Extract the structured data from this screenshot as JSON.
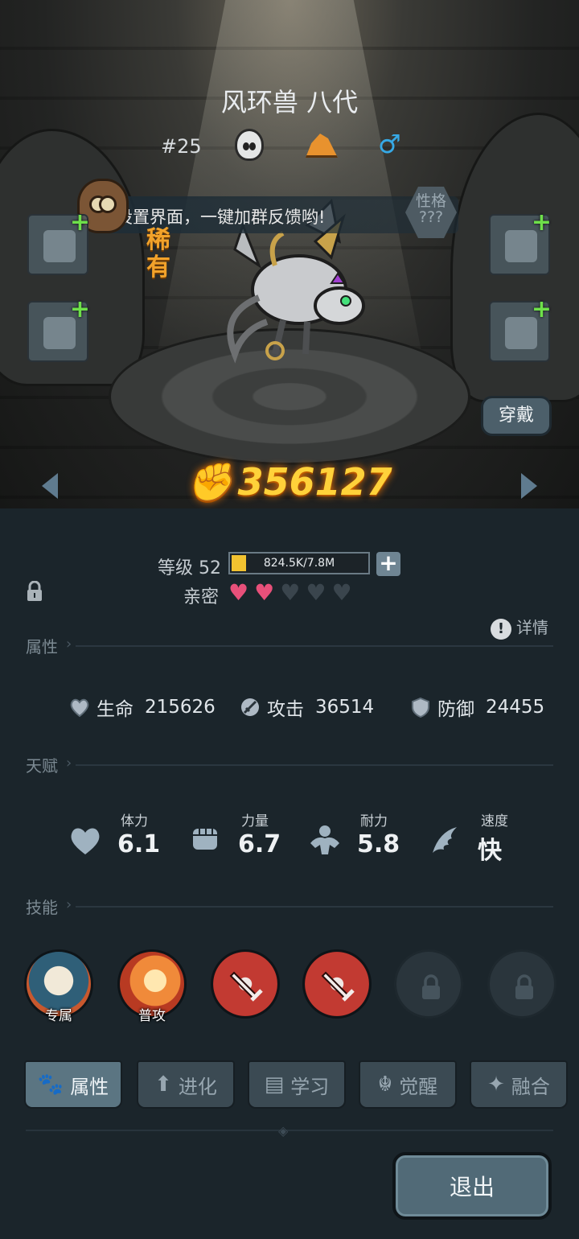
{
  "pet": {
    "name": "风环兽 八代",
    "number": "#25",
    "rarity": "稀有",
    "trait_label": "性格",
    "trait_value": "???",
    "gender_symbol": "♂",
    "power": "356127",
    "equip_label": "穿戴"
  },
  "tip": {
    "text": "设置界面，一键加群反馈哟!"
  },
  "level": {
    "label": "等级 52",
    "exp_text": "824.5K/7.8M",
    "exp_fraction": 0.106
  },
  "intimacy": {
    "label": "亲密",
    "filled": 2,
    "total": 5
  },
  "detail_label": "详情",
  "sections": {
    "attributes": "属性",
    "talent": "天赋",
    "skills": "技能"
  },
  "stats": [
    {
      "label": "生命",
      "value": "215626"
    },
    {
      "label": "攻击",
      "value": "36514"
    },
    {
      "label": "防御",
      "value": "24455"
    }
  ],
  "talents": [
    {
      "label": "体力",
      "value": "6.1"
    },
    {
      "label": "力量",
      "value": "6.7"
    },
    {
      "label": "耐力",
      "value": "5.8"
    },
    {
      "label": "速度",
      "value": "快"
    }
  ],
  "skills": [
    {
      "tag": "专属",
      "icon": "exclusive-skill-icon"
    },
    {
      "tag": "普攻",
      "icon": "normal-attack-icon"
    },
    {
      "tag": "",
      "icon": "sword-skill-icon"
    },
    {
      "tag": "",
      "icon": "sword-skill-icon"
    },
    {
      "tag": "",
      "icon": "padlock-icon"
    },
    {
      "tag": "",
      "icon": "padlock-icon"
    }
  ],
  "tabs": [
    {
      "label": "属性",
      "icon": "paw-icon",
      "active": true
    },
    {
      "label": "进化",
      "icon": "evolve-arrow-icon",
      "active": false
    },
    {
      "label": "学习",
      "icon": "book-icon",
      "active": false
    },
    {
      "label": "觉醒",
      "icon": "awaken-icon",
      "active": false
    },
    {
      "label": "融合",
      "icon": "fusion-icon",
      "active": false
    }
  ],
  "exit_label": "退出",
  "colors": {
    "accent_gold": "#ffd23a",
    "heart_filled": "#e8507a",
    "heart_empty": "#3a454d",
    "plus_green": "#6ee04a",
    "gender_blue": "#36a9e6",
    "terrain_orange": "#e8922e"
  }
}
